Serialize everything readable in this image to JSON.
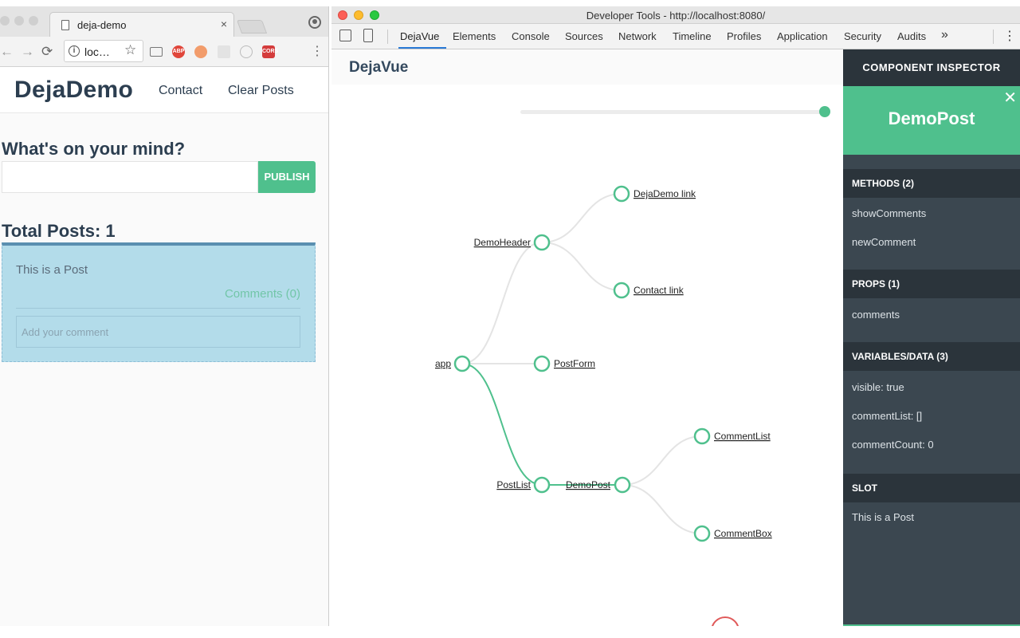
{
  "browser": {
    "tab_title": "deja-demo",
    "tab_close": "×",
    "url": "loc…",
    "extensions": [
      "ABP",
      "CORS"
    ],
    "nav": {
      "back": "←",
      "forward": "→",
      "reload": "⟳",
      "star": "☆",
      "menu": "⋮"
    }
  },
  "app": {
    "brand": "DejaDemo",
    "nav": [
      "Contact",
      "Clear Posts"
    ],
    "prompt": "What's on your mind?",
    "publish_label": "PUBLISH",
    "total_posts": "Total Posts: 1",
    "post": {
      "text": "This is a Post",
      "comments_link": "Comments (0)",
      "comment_placeholder": "Add your comment"
    }
  },
  "devtools": {
    "window_title": "Developer Tools - http://localhost:8080/",
    "tabs": [
      "DejaVue",
      "Elements",
      "Console",
      "Sources",
      "Network",
      "Timeline",
      "Profiles",
      "Application",
      "Security",
      "Audits"
    ],
    "active_tab": "DejaVue",
    "overflow": "»",
    "menu": "⋮",
    "panel_title": "DejaVue",
    "tree_nodes": {
      "app": "app",
      "demo_header": "DemoHeader",
      "dejademo_link": "DejaDemo link",
      "contact_link": "Contact link",
      "post_form": "PostForm",
      "post_list": "PostList",
      "demo_post": "DemoPost",
      "comment_list": "CommentList",
      "comment_box": "CommentBox"
    },
    "timeline_slider_position": 1.0
  },
  "inspector": {
    "header": "COMPONENT INSPECTOR",
    "component_name": "DemoPost",
    "close": "✕",
    "methods_header": "METHODS (2)",
    "methods": [
      "showComments",
      "newComment"
    ],
    "props_header": "PROPS (1)",
    "props": [
      "comments"
    ],
    "data_header": "VARIABLES/DATA (3)",
    "data": [
      "visible: true",
      "commentList: []",
      "commentCount: 0"
    ],
    "slot_header": "SLOT",
    "slot": [
      "This is a Post"
    ]
  },
  "colors": {
    "vue_green": "#4fc08d",
    "text_dark": "#2c3e50",
    "inspector_bg": "#3b4750",
    "inspector_header_bg": "#2b343b",
    "post_card_bg": "#b3dcea"
  }
}
